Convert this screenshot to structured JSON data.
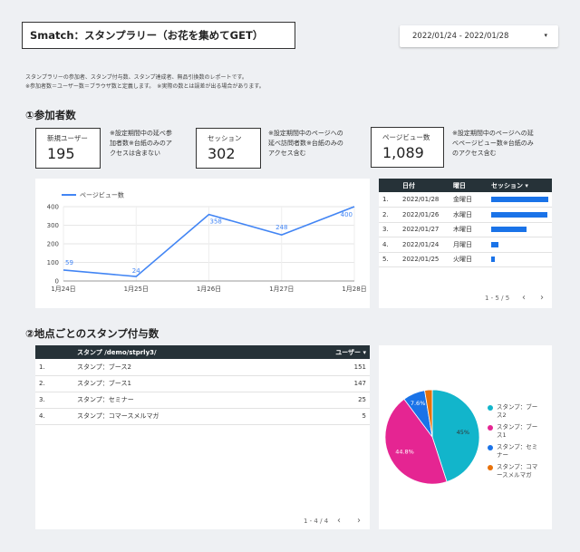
{
  "header": {
    "title": "Smatch：スタンプラリー（お花を集めてGET）",
    "date_range": "2022/01/24 - 2022/01/28",
    "caret": "▾"
  },
  "description": {
    "line1": "スタンプラリーの参加者、スタンプ付与数、スタンプ達成者、無品引換数のレポートです。",
    "line2": "※参加者数＝ユーザー数＝ブラウザ数と定義します。　※実際の数とは誤差が出る場合があります。"
  },
  "section1": {
    "title": "①参加者数",
    "kpis": [
      {
        "label": "新規ユーザー",
        "value": "195",
        "note_line1": "※設定期間中の延べ参",
        "note_line2": "加者数※台紙のみのア",
        "note_line3": "クセスは含まない"
      },
      {
        "label": "セッション",
        "value": "302",
        "note_line1": "※設定期間中のページへの",
        "note_line2": "延べ訪問者数※台紙のみの",
        "note_line3": "アクセス含む"
      },
      {
        "label": "ページビュー数",
        "value": "1,089",
        "note_line1": "※設定期間中のページへの延",
        "note_line2": "べページビュー数※台紙のみ",
        "note_line3": "のアクセス含む"
      }
    ]
  },
  "chart_data": {
    "type": "line",
    "categories": [
      "1月24日",
      "1月25日",
      "1月26日",
      "1月27日",
      "1月28日"
    ],
    "series": [
      {
        "name": "ページビュー数",
        "values": [
          59,
          24,
          358,
          248,
          400
        ],
        "color": "#4285f4"
      }
    ],
    "data_labels": [
      "59",
      "24",
      "358",
      "248",
      "400"
    ],
    "yticks": [
      "0",
      "100",
      "200",
      "300",
      "400"
    ],
    "ylim": [
      0,
      400
    ],
    "grid": true,
    "legend": "top-left"
  },
  "session_table": {
    "headers": {
      "num": "",
      "date": "日付",
      "weekday": "曜日",
      "sessions": "セッション ▾"
    },
    "rows": [
      {
        "num": "1.",
        "date": "2022/01/28",
        "weekday": "金曜日",
        "bar": 1.0
      },
      {
        "num": "2.",
        "date": "2022/01/26",
        "weekday": "水曜日",
        "bar": 0.98
      },
      {
        "num": "3.",
        "date": "2022/01/27",
        "weekday": "木曜日",
        "bar": 0.62
      },
      {
        "num": "4.",
        "date": "2022/01/24",
        "weekday": "月曜日",
        "bar": 0.13
      },
      {
        "num": "5.",
        "date": "2022/01/25",
        "weekday": "火曜日",
        "bar": 0.06
      }
    ],
    "pager": "1 - 5 / 5",
    "prev": "‹",
    "next": "›"
  },
  "section2": {
    "title": "②地点ごとのスタンプ付与数"
  },
  "stamp_table": {
    "headers": {
      "num": "",
      "path": "スタンプ /demo/stprly3/",
      "users": "ユーザー ▾"
    },
    "rows": [
      {
        "num": "1.",
        "path": "スタンプ：ブース2",
        "users": "151"
      },
      {
        "num": "2.",
        "path": "スタンプ：ブース1",
        "users": "147"
      },
      {
        "num": "3.",
        "path": "スタンプ：セミナー",
        "users": "25"
      },
      {
        "num": "4.",
        "path": "スタンプ：コマースメルマガ",
        "users": "5"
      }
    ],
    "pager": "1 - 4 / 4",
    "prev": "‹",
    "next": "›"
  },
  "pie": {
    "slices": [
      {
        "name": "スタンプ：ブース2",
        "value": 45.0,
        "label": "45%",
        "color": "#12b5cb"
      },
      {
        "name": "スタンプ：ブース1",
        "value": 44.8,
        "label": "44.8%",
        "color": "#e52592"
      },
      {
        "name": "スタンプ：セミナー",
        "value": 7.6,
        "label": "7.6%",
        "color": "#1a73e8"
      },
      {
        "name": "スタンプ：コマースメルマガ",
        "value": 2.6,
        "label": "",
        "color": "#e8710a"
      }
    ],
    "legend": [
      {
        "line1": "スタンプ：ブー",
        "line2": "ス2",
        "color": "#12b5cb"
      },
      {
        "line1": "スタンプ：ブー",
        "line2": "ス1",
        "color": "#e52592"
      },
      {
        "line1": "スタンプ：セミ",
        "line2": "ナー",
        "color": "#1a73e8"
      },
      {
        "line1": "スタンプ：コマ",
        "line2": "ースメルマガ",
        "color": "#e8710a"
      }
    ]
  }
}
